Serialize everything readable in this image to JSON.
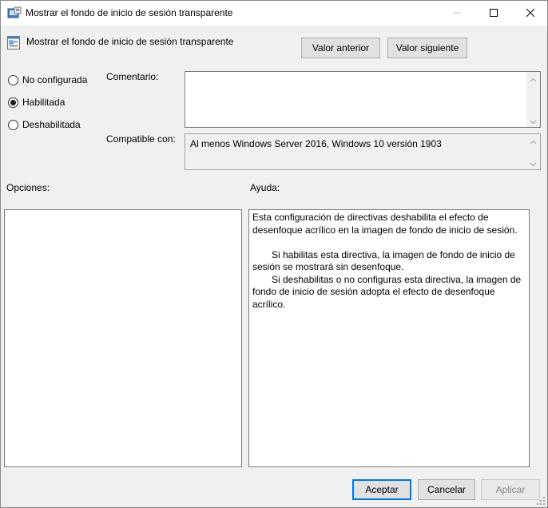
{
  "window": {
    "title": "Mostrar el fondo de inicio de sesión transparente"
  },
  "header": {
    "policy_title": "Mostrar el fondo de inicio de sesión transparente",
    "prev_label": "Valor anterior",
    "next_label": "Valor siguiente"
  },
  "state": {
    "options": [
      {
        "label": "No configurada",
        "checked": false
      },
      {
        "label": "Habilitada",
        "checked": true
      },
      {
        "label": "Deshabilitada",
        "checked": false
      }
    ]
  },
  "fields": {
    "comment_label": "Comentario:",
    "comment_value": "",
    "compat_label": "Compatible con:",
    "compat_value": "Al menos Windows Server 2016, Windows 10 versión 1903"
  },
  "panes": {
    "options_label": "Opciones:",
    "help_label": "Ayuda:",
    "help_paragraphs": [
      "Esta configuración de directivas deshabilita el efecto de desenfoque acrílico en la imagen de fondo de inicio de sesión.",
      "Si habilitas esta directiva, la imagen de fondo de inicio de sesión se mostrará sin desenfoque.",
      "Si deshabilitas o no configuras esta directiva, la imagen de fondo de inicio de sesión adopta el efecto de desenfoque acrílico."
    ]
  },
  "footer": {
    "ok_label": "Aceptar",
    "cancel_label": "Cancelar",
    "apply_label": "Aplicar"
  }
}
